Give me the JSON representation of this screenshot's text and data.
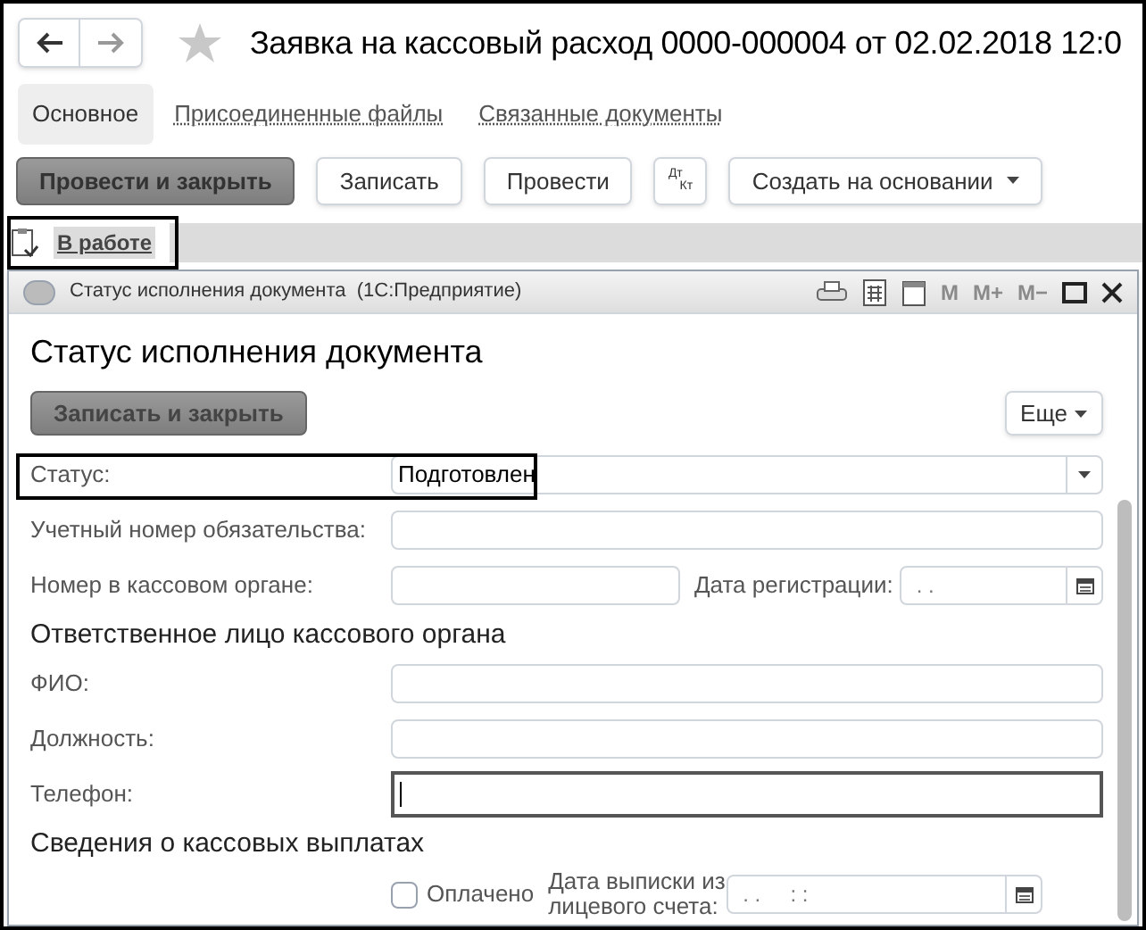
{
  "header": {
    "title": "Заявка на кассовый расход 0000-000004 от 02.02.2018 12:0"
  },
  "tabs": [
    {
      "label": "Основное",
      "selected": true
    },
    {
      "label": "Присоединенные файлы",
      "selected": false
    },
    {
      "label": "Связанные документы",
      "selected": false
    }
  ],
  "toolbar": [
    {
      "kind": "primary",
      "label": "Провести и закрыть"
    },
    {
      "kind": "plain",
      "label": "Записать"
    },
    {
      "kind": "plain",
      "label": "Провести"
    },
    {
      "kind": "dtkt",
      "label": "Дт",
      "label2": "Кт"
    },
    {
      "kind": "menu",
      "label": "Создать на основании"
    }
  ],
  "status_link": {
    "label": "В работе"
  },
  "dialog": {
    "title": "Статус исполнения документа  (1С:Предприятие)",
    "memory_buttons": [
      "M",
      "M+",
      "M−"
    ],
    "heading": "Статус исполнения документа",
    "save_button": "Записать и закрыть",
    "more_button": "Еще",
    "rows": [
      {
        "kind": "select",
        "label": "Статус:",
        "value": "Подготовлен",
        "highlighted": true
      },
      {
        "kind": "text",
        "label": "Учетный номер обязательства:",
        "focused": false
      },
      {
        "kind": "text_date",
        "label": "Номер в кассовом органе:",
        "date_label": "Дата регистрации:",
        "date_value": ". ."
      },
      {
        "kind": "section",
        "label": "Ответственное лицо кассового органа"
      },
      {
        "kind": "text",
        "label": "ФИО:",
        "focused": false
      },
      {
        "kind": "text",
        "label": "Должность:",
        "focused": false
      },
      {
        "kind": "text",
        "label": "Телефон:",
        "focused": true
      },
      {
        "kind": "section",
        "label": "Сведения о кассовых выплатах"
      },
      {
        "kind": "checkbox_date",
        "check_label": "Оплачено",
        "checked": false,
        "date_label": "Дата выписки из лицевого счета:",
        "date_value": ". .     : :"
      }
    ]
  }
}
